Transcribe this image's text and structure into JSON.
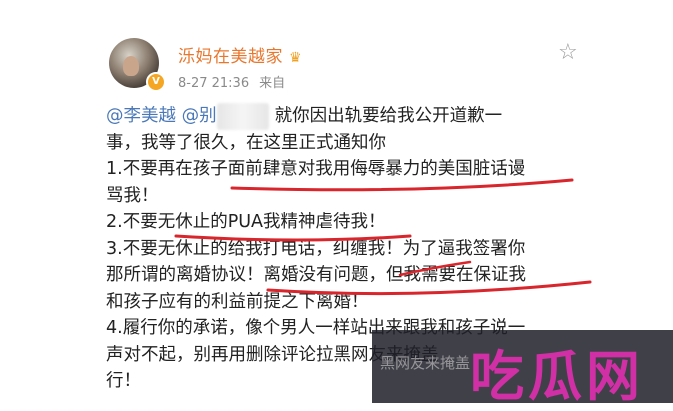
{
  "post": {
    "username": "泺妈在美越家",
    "crown_icon": "crown-icon",
    "timestamp": "8-27 21:36",
    "source": "来自",
    "lines": [
      {
        "prefix": "",
        "mention1": "@李美越",
        "mention2": "@别",
        "rest": " 就你因出轨要给我公开道歉一"
      },
      {
        "text": "事，我等了很久，在这里正式通知你"
      },
      {
        "text": "1.不要再在孩子面前肆意对我用侮辱暴力的美国脏话谩"
      },
      {
        "text": "骂我！"
      },
      {
        "text": "2.不要无休止的PUA我精神虐待我！"
      },
      {
        "text": "3.不要无休止的给我打电话，纠缠我！为了逼我签署你"
      },
      {
        "text": "那所谓的离婚协议！离婚没有问题，但我需要在保证我"
      },
      {
        "text": "和孩子应有的利益前提之下离婚！"
      },
      {
        "text": "4.履行你的承诺，像个男人一样站出来跟我和孩子说一"
      },
      {
        "text": "声对不起，别再用删除评论拉黑网友来掩盖"
      },
      {
        "text": "行！"
      }
    ]
  },
  "watermark": {
    "logo": "吃瓜网",
    "overlay_text": "黑网友来掩盖"
  },
  "colors": {
    "username": "#e8772e",
    "mention": "#4a78b8",
    "underline": "#d9252c",
    "watermark_logo": "#d12fa6"
  }
}
